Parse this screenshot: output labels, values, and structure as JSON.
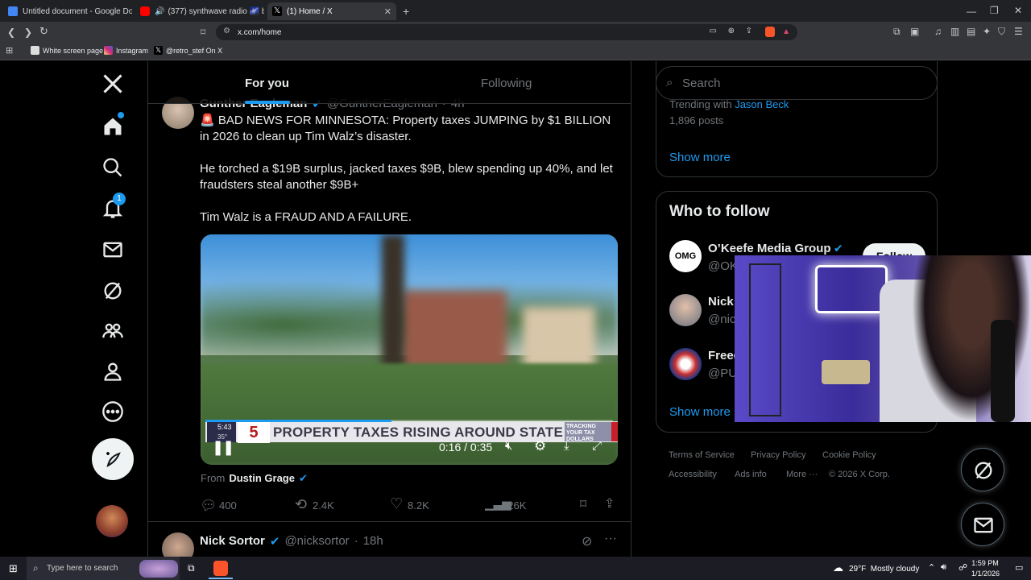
{
  "browser": {
    "tabs": [
      {
        "title": "Untitled document - Google Docs",
        "icon": "docs-icon",
        "color": "#4285f4"
      },
      {
        "title": "(377) synthwave radio 🌌 beats t",
        "icon": "youtube-icon",
        "color": "#ff0000"
      },
      {
        "title": "(1) Home / X",
        "icon": "x-icon",
        "color": "#ffffff",
        "active": true
      }
    ],
    "url": "x.com/home",
    "bookmarks": [
      {
        "label": "White screen page",
        "icon": "page-icon"
      },
      {
        "label": "Instagram",
        "icon": "instagram-icon"
      },
      {
        "label": "@retro_stef On X",
        "icon": "x-icon"
      }
    ]
  },
  "nav": {
    "notifications_badge": "1"
  },
  "feed": {
    "tabs": [
      "For you",
      "Following"
    ],
    "post1": {
      "author_name": "Gunther Eagleman",
      "author_handle": "@GuntherEagleman",
      "time": "4h",
      "para1": "🚨 BAD NEWS FOR MINNESOTA: Property taxes JUMPING by $1 BILLION in 2026 to clean up Tim Walz’s disaster.",
      "para2": "He torched a $19B surplus, jacked taxes $9B, blew spending up 40%, and let fraudsters steal another $9B+",
      "para3": "Tim Walz is a FRAUD AND A FAILURE.",
      "video": {
        "banner_text": "PROPERTY TAXES RISING AROUND STATE",
        "tracking_text": "TRACKING YOUR TAX DOLLARS",
        "clock": "5:43",
        "temp": "35°",
        "time": "0:16 / 0:35",
        "progress": 0.457
      },
      "from_label": "From",
      "from_name": "Dustin Grage",
      "replies": "400",
      "reposts": "2.4K",
      "likes": "8.2K",
      "views": "126K"
    },
    "post2": {
      "author_name": "Nick Sortor",
      "author_handle": "@nicksortor",
      "time": "18h"
    }
  },
  "sidebar": {
    "search_placeholder": "Search",
    "trending_prefix": "Trending with",
    "trending_link": "Jason Beck",
    "trending_posts": "1,896 posts",
    "show_more": "Show more",
    "who_to_follow_title": "Who to follow",
    "follow_label": "Follow",
    "accounts": [
      {
        "name": "O’Keefe Media Group",
        "handle": "@OK"
      },
      {
        "name": "Nick",
        "handle": "@nic"
      },
      {
        "name": "Freed",
        "handle": "@PU"
      }
    ],
    "show_more_2": "Show more",
    "footer": [
      "Terms of Service",
      "Privacy Policy",
      "Cookie Policy",
      "Accessibility",
      "Ads info",
      "More ···",
      "© 2026 X Corp."
    ]
  },
  "taskbar": {
    "search_placeholder": "Type here to search",
    "weather": "29°F  Mostly cloudy",
    "time": "1:59 PM",
    "date": "1/1/2026"
  },
  "colors": {
    "accent": "#1d9bf0",
    "bg": "#000000",
    "border": "#2f3336",
    "muted": "#71767b"
  }
}
